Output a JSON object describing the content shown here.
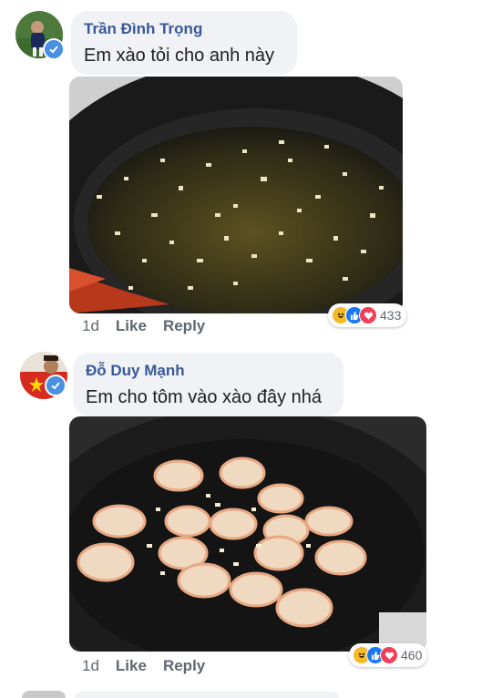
{
  "comments": [
    {
      "author": "Trần Đình Trọng",
      "text": "Em xào tỏi cho anh này",
      "photo_icon": "garlic-in-pan",
      "time": "1d",
      "like_label": "Like",
      "reply_label": "Reply",
      "reaction_count": "433",
      "reactions": [
        "haha-icon",
        "like-icon",
        "love-icon"
      ]
    },
    {
      "author": "Đỗ Duy Mạnh",
      "text": "Em cho tôm vào xào đây nhá",
      "photo_icon": "shrimp-in-pan",
      "time": "1d",
      "like_label": "Like",
      "reply_label": "Reply",
      "reaction_count": "460",
      "reactions": [
        "haha-icon",
        "like-icon",
        "love-icon"
      ]
    }
  ],
  "colors": {
    "bubble": "#f0f2f5",
    "author": "#385898",
    "meta": "#606770",
    "like_blue": "#1877f2",
    "love_red": "#f33e58",
    "haha_yellow": "#f7b928"
  }
}
